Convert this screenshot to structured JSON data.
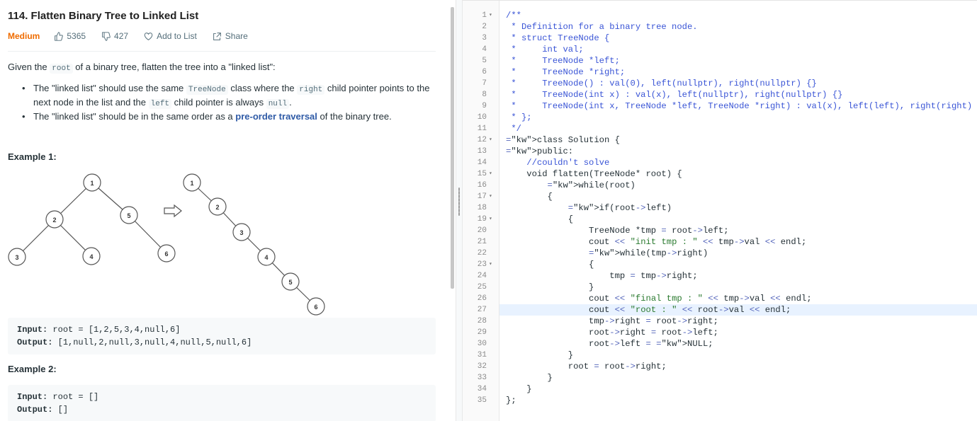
{
  "problem": {
    "title": "114. Flatten Binary Tree to Linked List",
    "difficulty": "Medium",
    "likes": "5365",
    "dislikes": "427",
    "add_to_list": "Add to List",
    "share": "Share"
  },
  "description": {
    "intro_before": "Given the ",
    "intro_code": "root",
    "intro_after": " of a binary tree, flatten the tree into a \"linked list\":",
    "bullet1_a": "The \"linked list\" should use the same ",
    "bullet1_code1": "TreeNode",
    "bullet1_b": " class where the ",
    "bullet1_code2": "right",
    "bullet1_c": " child pointer points to the next node in the list and the ",
    "bullet1_code3": "left",
    "bullet1_d": " child pointer is always ",
    "bullet1_code4": "null",
    "bullet1_e": ".",
    "bullet2_a": "The \"linked list\" should be in the same order as a ",
    "bullet2_link": "pre-order traversal",
    "bullet2_b": " of the binary tree."
  },
  "examples": [
    {
      "title": "Example 1:",
      "input_label": "Input:",
      "input_value": " root = [1,2,5,3,4,null,6]",
      "output_label": "Output:",
      "output_value": " [1,null,2,null,3,null,4,null,5,null,6]",
      "tree_nodes": [
        "1",
        "2",
        "5",
        "3",
        "4",
        "6"
      ],
      "list_nodes": [
        "1",
        "2",
        "3",
        "4",
        "5",
        "6"
      ]
    },
    {
      "title": "Example 2:",
      "input_label": "Input:",
      "input_value": " root = []",
      "output_label": "Output:",
      "output_value": " []"
    }
  ],
  "editor": {
    "active_line": 27,
    "lines": [
      {
        "n": "1",
        "fold": true,
        "t": "/**",
        "c": "cm"
      },
      {
        "n": "2",
        "fold": false,
        "t": " * Definition for a binary tree node.",
        "c": "cm"
      },
      {
        "n": "3",
        "fold": false,
        "t": " * struct TreeNode {",
        "c": "cm"
      },
      {
        "n": "4",
        "fold": false,
        "t": " *     int val;",
        "c": "cm"
      },
      {
        "n": "5",
        "fold": false,
        "t": " *     TreeNode *left;",
        "c": "cm"
      },
      {
        "n": "6",
        "fold": false,
        "t": " *     TreeNode *right;",
        "c": "cm"
      },
      {
        "n": "7",
        "fold": false,
        "t": " *     TreeNode() : val(0), left(nullptr), right(nullptr) {}",
        "c": "cm"
      },
      {
        "n": "8",
        "fold": false,
        "t": " *     TreeNode(int x) : val(x), left(nullptr), right(nullptr) {}",
        "c": "cm"
      },
      {
        "n": "9",
        "fold": false,
        "t": " *     TreeNode(int x, TreeNode *left, TreeNode *right) : val(x), left(left), right(right) {}",
        "c": "cm"
      },
      {
        "n": "10",
        "fold": false,
        "t": " * };",
        "c": "cm"
      },
      {
        "n": "11",
        "fold": false,
        "t": " */",
        "c": "cm"
      },
      {
        "n": "12",
        "fold": true,
        "t": "class Solution {",
        "c": "kw"
      },
      {
        "n": "13",
        "fold": false,
        "t": "public:",
        "c": "kw"
      },
      {
        "n": "14",
        "fold": false,
        "t": "    //couldn't solve",
        "c": "cm"
      },
      {
        "n": "15",
        "fold": true,
        "t": "    void flatten(TreeNode* root) {",
        "c": ""
      },
      {
        "n": "16",
        "fold": false,
        "t": "        while(root)",
        "c": ""
      },
      {
        "n": "17",
        "fold": true,
        "t": "        {",
        "c": ""
      },
      {
        "n": "18",
        "fold": false,
        "t": "            if(root->left)",
        "c": ""
      },
      {
        "n": "19",
        "fold": true,
        "t": "            {",
        "c": ""
      },
      {
        "n": "20",
        "fold": false,
        "t": "                TreeNode *tmp = root->left;",
        "c": ""
      },
      {
        "n": "21",
        "fold": false,
        "t": "                cout << \"init tmp : \" << tmp->val << endl;",
        "c": ""
      },
      {
        "n": "22",
        "fold": false,
        "t": "                while(tmp->right)",
        "c": ""
      },
      {
        "n": "23",
        "fold": true,
        "t": "                {",
        "c": ""
      },
      {
        "n": "24",
        "fold": false,
        "t": "                    tmp = tmp->right;",
        "c": ""
      },
      {
        "n": "25",
        "fold": false,
        "t": "                }",
        "c": ""
      },
      {
        "n": "26",
        "fold": false,
        "t": "                cout << \"final tmp : \" << tmp->val << endl;",
        "c": ""
      },
      {
        "n": "27",
        "fold": false,
        "t": "                cout << \"root : \" << root->val << endl;",
        "c": ""
      },
      {
        "n": "28",
        "fold": false,
        "t": "                tmp->right = root->right;",
        "c": ""
      },
      {
        "n": "29",
        "fold": false,
        "t": "                root->right = root->left;",
        "c": ""
      },
      {
        "n": "30",
        "fold": false,
        "t": "                root->left = NULL;",
        "c": ""
      },
      {
        "n": "31",
        "fold": false,
        "t": "            }",
        "c": ""
      },
      {
        "n": "32",
        "fold": false,
        "t": "            root = root->right;",
        "c": ""
      },
      {
        "n": "33",
        "fold": false,
        "t": "        }",
        "c": ""
      },
      {
        "n": "34",
        "fold": false,
        "t": "    }",
        "c": ""
      },
      {
        "n": "35",
        "fold": false,
        "t": "};",
        "c": ""
      }
    ]
  }
}
